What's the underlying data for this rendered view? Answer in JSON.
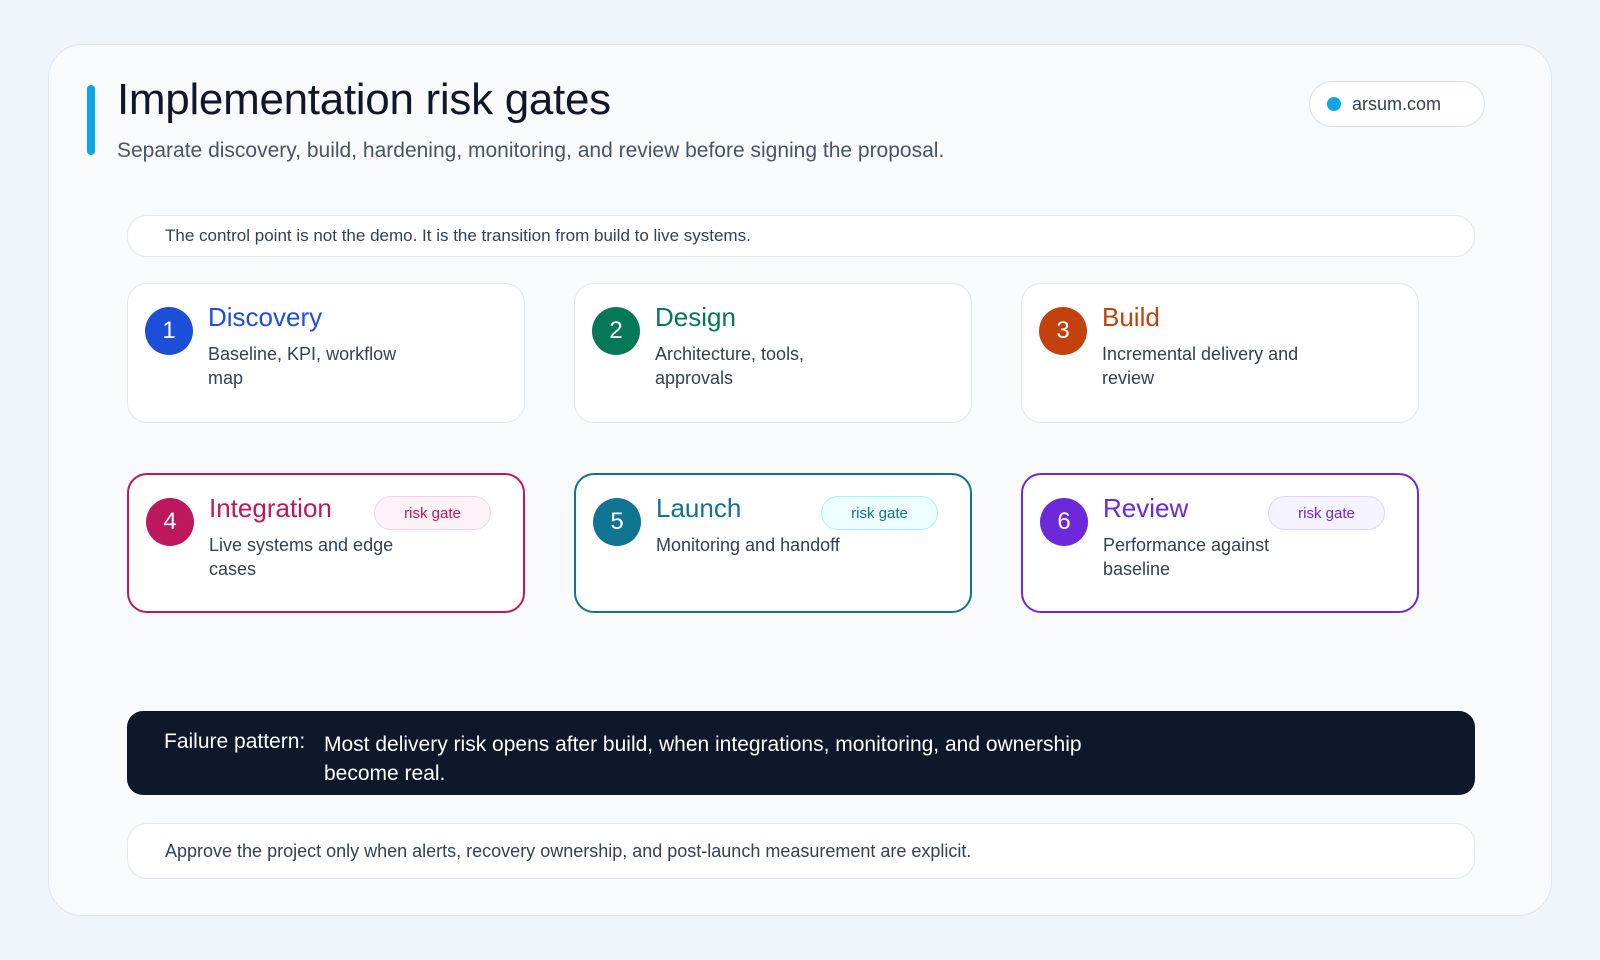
{
  "header": {
    "title": "Implementation risk gates",
    "subtitle": "Separate discovery, build, hardening, monitoring, and review before signing the proposal.",
    "brand": "arsum.com",
    "accent_color": "#0ea5e9"
  },
  "notes": {
    "top": "The control point is not the demo. It is the transition from build to live systems.",
    "bottom": "Approve the project only when alerts, recovery ownership, and post-launch measurement are explicit."
  },
  "stages": [
    {
      "number": "1",
      "title": "Discovery",
      "description": "Baseline, KPI, workflow map",
      "color": "#1d4ed8",
      "risk_gate": false
    },
    {
      "number": "2",
      "title": "Design",
      "description": "Architecture, tools, approvals",
      "color": "#047857",
      "risk_gate": false
    },
    {
      "number": "3",
      "title": "Build",
      "description": "Incremental delivery and review",
      "color": "#c2410c",
      "risk_gate": false
    },
    {
      "number": "4",
      "title": "Integration",
      "description": "Live systems and edge cases",
      "color": "#be185d",
      "risk_gate": true,
      "badge": "risk gate",
      "badge_bg": "#fdf2f8",
      "badge_border": "#fbcfe8"
    },
    {
      "number": "5",
      "title": "Launch",
      "description": "Monitoring and handoff",
      "color": "#0e7490",
      "risk_gate": true,
      "badge": "risk gate",
      "badge_bg": "#ecfeff",
      "badge_border": "#a5f3fc"
    },
    {
      "number": "6",
      "title": "Review",
      "description": "Performance against baseline",
      "color": "#6d28d9",
      "risk_gate": true,
      "badge": "risk gate",
      "badge_bg": "#f5f3ff",
      "badge_border": "#ddd6fe"
    }
  ],
  "failure": {
    "label": "Failure pattern:",
    "text": "Most delivery risk opens after build, when integrations, monitoring, and ownership become real.",
    "background": "#0f172a"
  }
}
